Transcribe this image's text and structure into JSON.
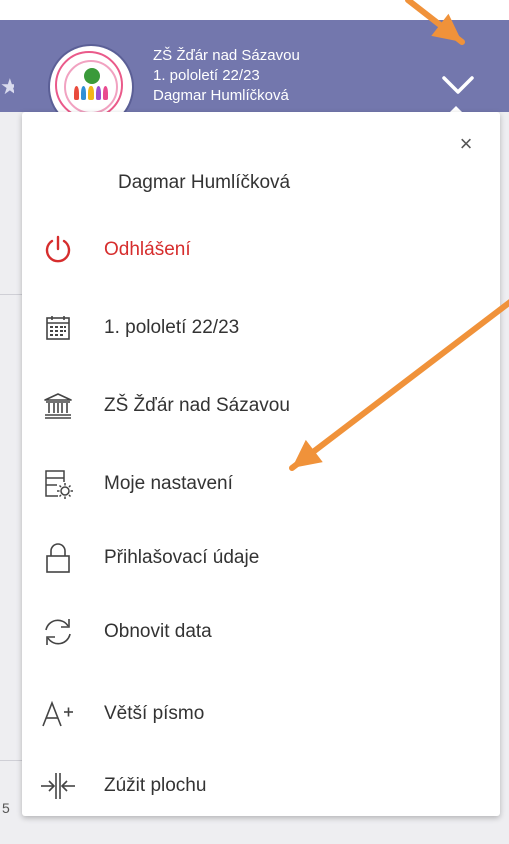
{
  "header": {
    "school": "ZŠ Žďár nad Sázavou",
    "period": "1. pololetí 22/23",
    "user": "Dagmar Humlíčková",
    "chevron_icon": "chevron-down-icon",
    "background_color": "#7377ad"
  },
  "dropdown": {
    "close_icon": "close-icon",
    "close_label": "×",
    "user_name": "Dagmar Humlíčková",
    "items": [
      {
        "label": "Odhlášení",
        "icon": "power-icon",
        "color": "#d62d2d"
      },
      {
        "label": "1. pololetí 22/23",
        "icon": "calendar-icon"
      },
      {
        "label": "ZŠ Žďár nad Sázavou",
        "icon": "institution-icon"
      },
      {
        "label": "Moje nastavení",
        "icon": "settings-form-icon"
      },
      {
        "label": "Přihlašovací údaje",
        "icon": "lock-icon"
      },
      {
        "label": "Obnovit data",
        "icon": "refresh-icon"
      },
      {
        "label": "Větší písmo",
        "icon": "font-larger-icon"
      },
      {
        "label": "Zúžit plochu",
        "icon": "narrow-width-icon"
      }
    ]
  },
  "annotation": {
    "arrow_color": "#f0923a"
  }
}
